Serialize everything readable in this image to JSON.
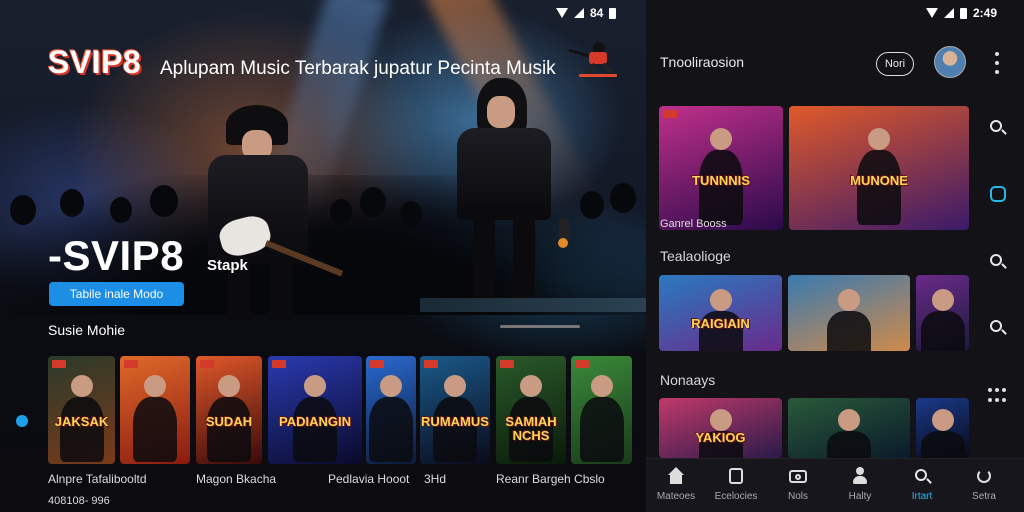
{
  "status_left": {
    "time": "84"
  },
  "status_right": {
    "time": "2:49"
  },
  "hero": {
    "brand": "SVIP8",
    "tagline": "Aplupam Music Terbarak jupatur Pecinta Musik",
    "big_title": "-SVIP8",
    "big_sub": "Stapk",
    "cta_label": "Tabile inale Modo"
  },
  "row": {
    "title": "Susie Mohie",
    "cards": [
      {
        "text": "JAKSAK",
        "colors": [
          "#2a3a2a",
          "#7a3a1a"
        ]
      },
      {
        "text": "",
        "colors": [
          "#e06a2a",
          "#8a1a10"
        ]
      },
      {
        "text": "SUDAH",
        "colors": [
          "#e0582a",
          "#3a0a0a"
        ]
      },
      {
        "text": "PADIANGIN",
        "colors": [
          "#2a3ab0",
          "#0a0a2a"
        ]
      },
      {
        "text": "",
        "colors": [
          "#2a6ad0",
          "#0a1a3a"
        ]
      },
      {
        "text": "RUMAMUS",
        "colors": [
          "#1a5a8a",
          "#0a0a1a"
        ]
      },
      {
        "text": "SAMIAH NCHS",
        "colors": [
          "#2a5a2a",
          "#0a1a0a"
        ]
      },
      {
        "text": "",
        "colors": [
          "#3a8a3a",
          "#1a3a1a"
        ]
      }
    ],
    "labels": [
      "Alnpre Tafalibooltd",
      "Magon Bkacha",
      "Pedlavia Hooot",
      "3Hd",
      "Reanr Bargeh Cbslo"
    ],
    "meta": "408108-  996"
  },
  "panel": {
    "title": "Tnooliraosion",
    "pill_label": "Nori",
    "section1_caption": "Ganrel Booss",
    "section1_cards": [
      {
        "text": "TUNNNIS",
        "colors": [
          "#c0308a",
          "#2a0a4a"
        ]
      },
      {
        "text": "MUNONE",
        "colors": [
          "#e05a2a",
          "#3a1a6a"
        ]
      }
    ],
    "section2_title": "Tealaolioge",
    "section2_cards": [
      {
        "text": "RAIGIAIN",
        "colors": [
          "#2a7ac0",
          "#6a2a8a"
        ]
      },
      {
        "text": "",
        "colors": [
          "#3a7ab0",
          "#d08a4a"
        ]
      },
      {
        "text": "",
        "colors": [
          "#6a2a8a",
          "#1a1a3a"
        ]
      }
    ],
    "section3_title": "Nonaays",
    "section3_cards": [
      {
        "text": "YAKIOG",
        "colors": [
          "#c03a6a",
          "#2a1a4a"
        ]
      },
      {
        "text": "",
        "colors": [
          "#2a5a3a",
          "#0a1a2a"
        ]
      },
      {
        "text": "",
        "colors": [
          "#1a3a8a",
          "#0a0a1a"
        ]
      }
    ],
    "nav": [
      {
        "label": "Mateoes",
        "icon": "home-icon"
      },
      {
        "label": "Ecelocies",
        "icon": "library-icon"
      },
      {
        "label": "Nols",
        "icon": "camera-icon"
      },
      {
        "label": "Halty",
        "icon": "profile-icon"
      },
      {
        "label": "Irtart",
        "icon": "search-icon"
      },
      {
        "label": "Setra",
        "icon": "refresh-icon"
      }
    ]
  },
  "colors": {
    "accent": "#1c8ee6",
    "active_nav": "#28b8e8",
    "brand_red": "#d6342a"
  }
}
